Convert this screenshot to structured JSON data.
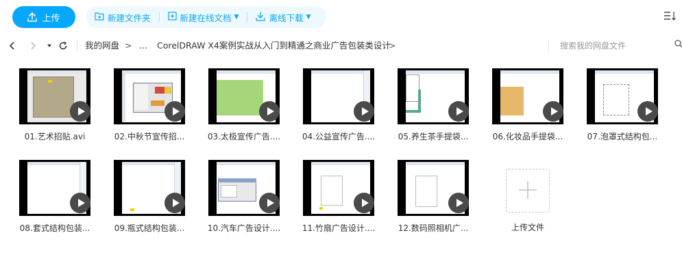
{
  "toolbar": {
    "upload_label": "上传",
    "new_folder_label": "新建文件夹",
    "new_online_doc_label": "新建在线文档",
    "offline_download_label": "离线下载",
    "sort_icon": "sort-icon"
  },
  "nav": {
    "back_icon": "chevron-left-icon",
    "forward_icon": "chevron-right-icon",
    "refresh_icon": "refresh-icon",
    "breadcrumb": {
      "root": "我的网盘",
      "ellipsis": "...",
      "current": "CorelDRAW X4案例实战从入门到精通之商业广告包装类设计",
      "separator": ">"
    },
    "search_placeholder": "搜索我的网盘文件"
  },
  "files": [
    {
      "name": "01.艺术招贴.avi"
    },
    {
      "name": "02.中秋节宣传招..."
    },
    {
      "name": "03.太极宣传广告...."
    },
    {
      "name": "04.公益宣传广告...."
    },
    {
      "name": "05.养生茶手提袋..."
    },
    {
      "name": "06.化妆品手提袋..."
    },
    {
      "name": "07.泡罩式结构包..."
    },
    {
      "name": "08.套式结构包装..."
    },
    {
      "name": "09.瓶式结构包装..."
    },
    {
      "name": "10.汽车广告设计...."
    },
    {
      "name": "11.竹扇广告设计...."
    },
    {
      "name": "12.数码照相机广..."
    }
  ],
  "upload_tile": {
    "label": "上传文件",
    "icon": "plus-icon"
  },
  "colors": {
    "accent": "#06a7ff",
    "accent_bg": "#eef8ff"
  }
}
